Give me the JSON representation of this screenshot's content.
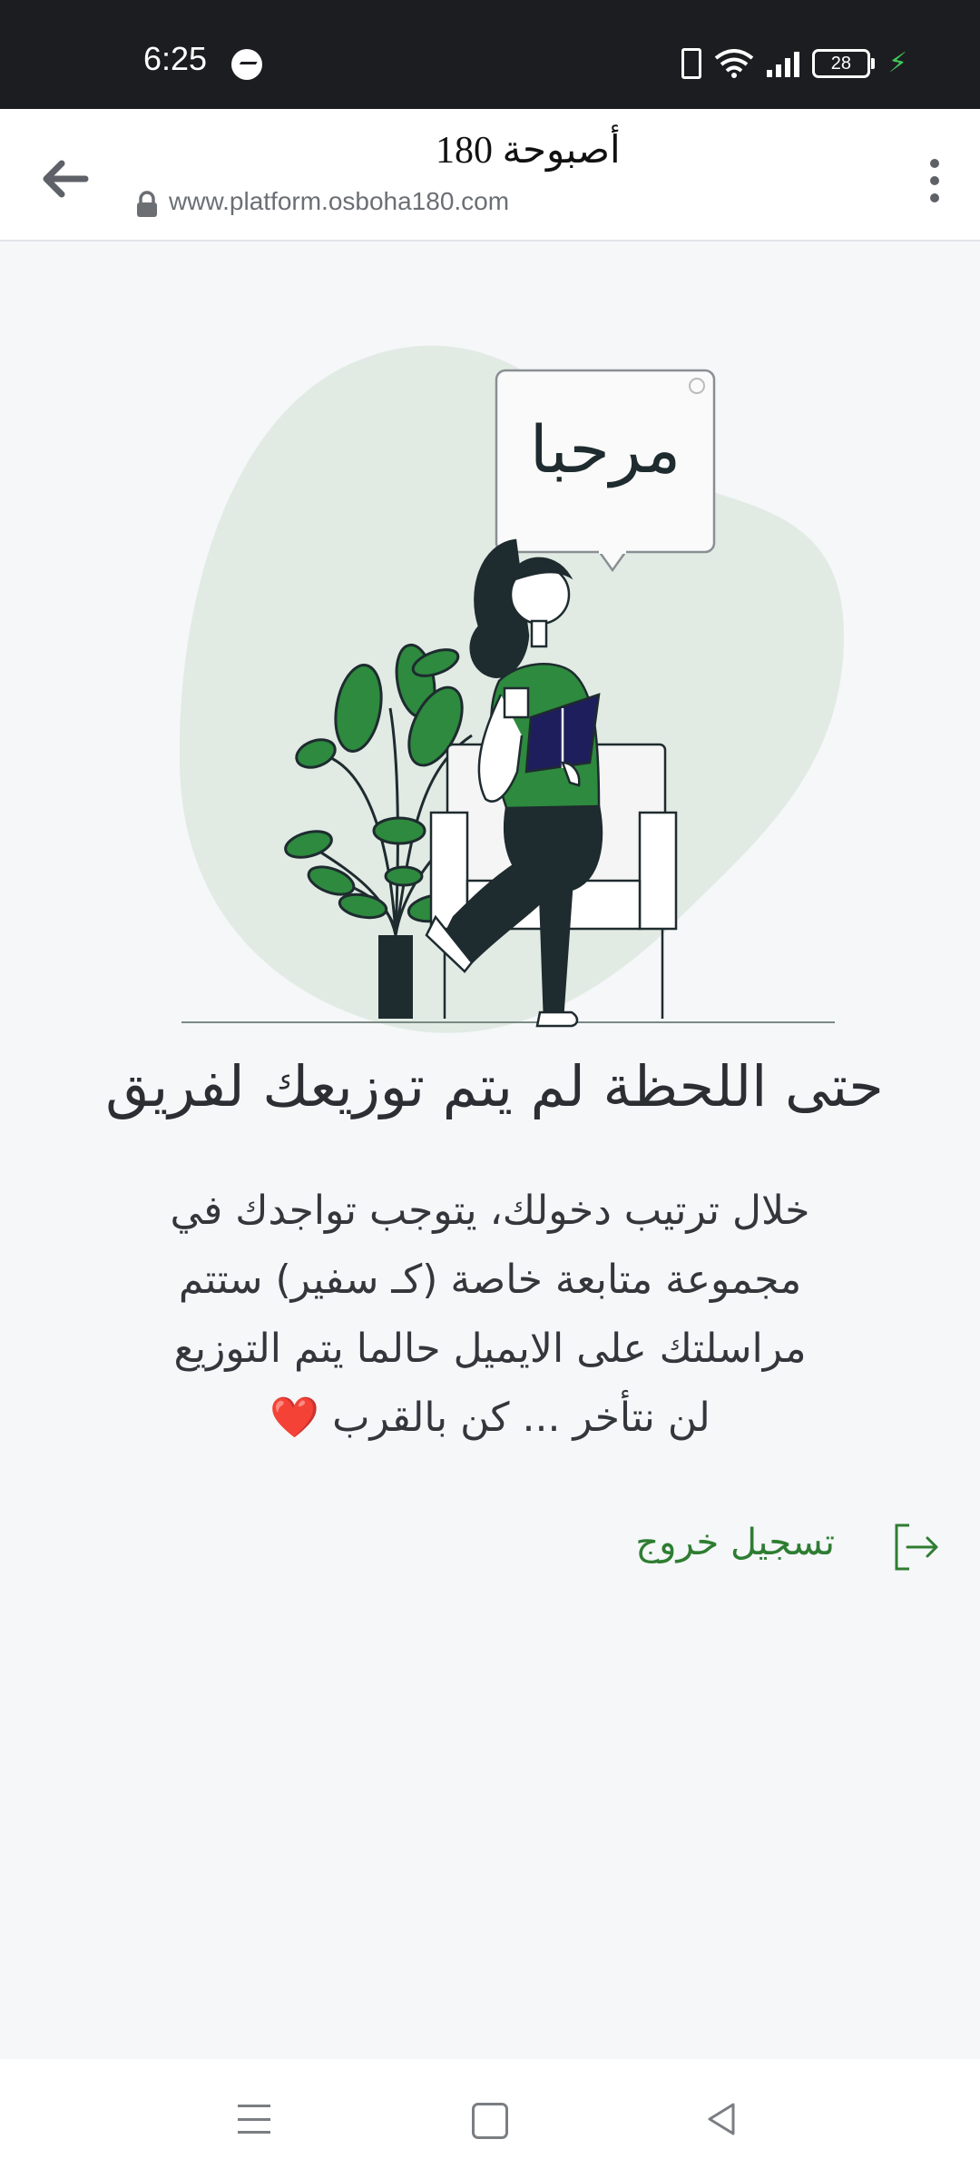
{
  "status_bar": {
    "time": "6:25",
    "battery": "28",
    "icons": [
      "messenger-icon",
      "vibrate-icon",
      "wifi-icon",
      "signal-icon",
      "battery-icon",
      "charging-icon"
    ]
  },
  "browser": {
    "title": "أصبوحة 180",
    "url": "www.platform.osboha180.com",
    "icons": [
      "back-arrow-icon",
      "lock-icon",
      "more-vert-icon"
    ]
  },
  "illustration": {
    "speech_bubble_text": "مرحبا"
  },
  "content": {
    "heading": "حتى اللحظة لم يتم توزيعك لفريق",
    "lines": [
      "خلال ترتيب دخولك، يتوجب تواجدك في",
      "مجموعة متابعة خاصة (كـ سفير) ستتم",
      "مراسلتك على الايميل حالما يتم التوزيع"
    ],
    "last_line": "لن نتأخر ... كن بالقرب",
    "heart": "❤️"
  },
  "logout": {
    "label": "تسجيل خروج",
    "icon": "logout-icon"
  },
  "colors": {
    "accent_green": "#2e7d32",
    "illustration_green": "#2d8a3e",
    "blob": "#e1ebe4"
  }
}
